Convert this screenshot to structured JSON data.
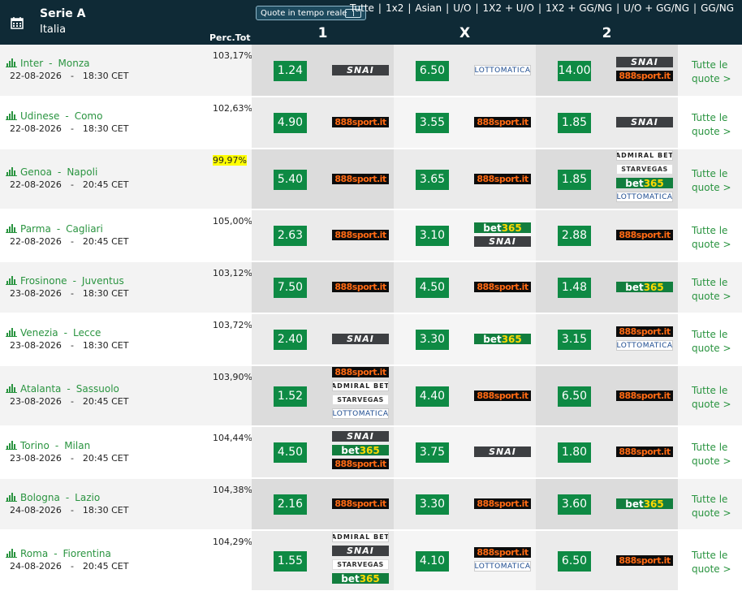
{
  "header": {
    "competition": "Serie A",
    "country": "Italia",
    "live_toggle_label": "Quote in tempo reale",
    "markets": [
      "Tutte",
      "1x2",
      "Asian",
      "U/O",
      "1X2 + U/O",
      "1X2 + GG/NG",
      "U/O + GG/NG",
      "GG/NG"
    ],
    "perc_tot_label": "Perc.Tot",
    "col_1": "1",
    "col_x": "X",
    "col_2": "2",
    "colors": {
      "header_bg": "#0f2a36",
      "odd_bg": "#0e8a44",
      "link": "#2a9440",
      "highlight": "#ffff00"
    }
  },
  "bookmaker_names": {
    "snai": "SNAI",
    "888": "888sport.it",
    "bet365": "bet365",
    "lotto": "LOTTOMATICA",
    "admiral": "ADMIRAL BET",
    "starvegas": "STARVEGAS"
  },
  "matches": [
    {
      "home": "Inter",
      "away": "Monza",
      "date": "22-08-2026",
      "time": "18:30 CET",
      "perc": "103,17%",
      "highlight": false,
      "o1": "1.24",
      "b1": [
        "snai"
      ],
      "ox": "6.50",
      "bx": [
        "lotto"
      ],
      "o2": "14.00",
      "b2": [
        "snai",
        "888"
      ],
      "more1": "Tutte le",
      "more2": "quote >"
    },
    {
      "home": "Udinese",
      "away": "Como",
      "date": "22-08-2026",
      "time": "18:30 CET",
      "perc": "102,63%",
      "highlight": false,
      "o1": "4.90",
      "b1": [
        "888"
      ],
      "ox": "3.55",
      "bx": [
        "888"
      ],
      "o2": "1.85",
      "b2": [
        "snai"
      ],
      "more1": "Tutte le",
      "more2": "quote >"
    },
    {
      "home": "Genoa",
      "away": "Napoli",
      "date": "22-08-2026",
      "time": "20:45 CET",
      "perc": "99,97%",
      "highlight": true,
      "o1": "5.40",
      "b1": [
        "888"
      ],
      "ox": "3.65",
      "bx": [
        "888"
      ],
      "o2": "1.85",
      "b2": [
        "admiral",
        "starvegas",
        "bet365",
        "lotto"
      ],
      "more1": "Tutte le",
      "more2": "quote >"
    },
    {
      "home": "Parma",
      "away": "Cagliari",
      "date": "22-08-2026",
      "time": "20:45 CET",
      "perc": "105,00%",
      "highlight": false,
      "o1": "2.63",
      "b1": [
        "888"
      ],
      "ox": "3.10",
      "bx": [
        "bet365",
        "snai"
      ],
      "o2": "2.88",
      "b2": [
        "888"
      ],
      "more1": "Tutte le",
      "more2": "quote >"
    },
    {
      "home": "Frosinone",
      "away": "Juventus",
      "date": "23-08-2026",
      "time": "18:30 CET",
      "perc": "103,12%",
      "highlight": false,
      "o1": "7.50",
      "b1": [
        "888"
      ],
      "ox": "4.50",
      "bx": [
        "888"
      ],
      "o2": "1.48",
      "b2": [
        "bet365"
      ],
      "more1": "Tutte le",
      "more2": "quote >"
    },
    {
      "home": "Venezia",
      "away": "Lecce",
      "date": "23-08-2026",
      "time": "18:30 CET",
      "perc": "103,72%",
      "highlight": false,
      "o1": "2.40",
      "b1": [
        "snai"
      ],
      "ox": "3.30",
      "bx": [
        "bet365"
      ],
      "o2": "3.15",
      "b2": [
        "888",
        "lotto"
      ],
      "more1": "Tutte le",
      "more2": "quote >"
    },
    {
      "home": "Atalanta",
      "away": "Sassuolo",
      "date": "23-08-2026",
      "time": "20:45 CET",
      "perc": "103,90%",
      "highlight": false,
      "o1": "1.52",
      "b1": [
        "888",
        "admiral",
        "starvegas",
        "lotto"
      ],
      "ox": "4.40",
      "bx": [
        "888"
      ],
      "o2": "6.50",
      "b2": [
        "888"
      ],
      "more1": "Tutte le",
      "more2": "quote >"
    },
    {
      "home": "Torino",
      "away": "Milan",
      "date": "23-08-2026",
      "time": "20:45 CET",
      "perc": "104,44%",
      "highlight": false,
      "o1": "4.50",
      "b1": [
        "snai",
        "bet365",
        "888"
      ],
      "ox": "3.75",
      "bx": [
        "snai"
      ],
      "o2": "1.80",
      "b2": [
        "888"
      ],
      "more1": "Tutte le",
      "more2": "quote >"
    },
    {
      "home": "Bologna",
      "away": "Lazio",
      "date": "24-08-2026",
      "time": "18:30 CET",
      "perc": "104,38%",
      "highlight": false,
      "o1": "2.16",
      "b1": [
        "888"
      ],
      "ox": "3.30",
      "bx": [
        "888"
      ],
      "o2": "3.60",
      "b2": [
        "bet365"
      ],
      "more1": "Tutte le",
      "more2": "quote >"
    },
    {
      "home": "Roma",
      "away": "Fiorentina",
      "date": "24-08-2026",
      "time": "20:45 CET",
      "perc": "104,29%",
      "highlight": false,
      "o1": "1.55",
      "b1": [
        "admiral",
        "snai",
        "starvegas",
        "bet365"
      ],
      "ox": "4.10",
      "bx": [
        "888",
        "lotto"
      ],
      "o2": "6.50",
      "b2": [
        "888"
      ],
      "more1": "Tutte le",
      "more2": "quote >"
    }
  ]
}
